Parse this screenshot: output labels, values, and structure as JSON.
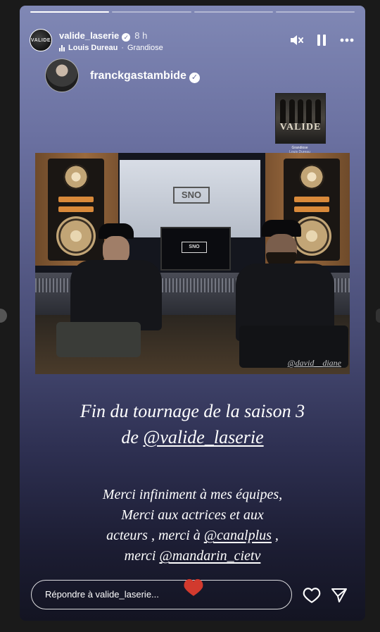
{
  "story": {
    "progress": [
      1,
      0,
      0,
      0
    ],
    "account": {
      "username": "valide_laserie",
      "time": "8 h",
      "avatar_text": "VALIDE"
    },
    "music": {
      "artist": "Louis Dureau",
      "separator": "·",
      "track": "Grandiose"
    },
    "icons": {
      "verified": "verified-badge-icon",
      "music": "music-bars-icon",
      "mute": "speaker-muted-icon",
      "pause": "pause-icon",
      "more": "more-horizontal-icon"
    }
  },
  "tagged": {
    "username": "franckgastambide"
  },
  "album": {
    "title": "VALIDE",
    "caption_line1": "Grandiose",
    "caption_line2": "Louis Dureau"
  },
  "photo": {
    "screen_logo": "SNO",
    "monitor_logo": "SNO",
    "credit": "@david__diane"
  },
  "caption1": {
    "line1": "Fin du tournage de la saison 3",
    "line2_prefix": "de ",
    "mention": "@valide_laserie"
  },
  "caption2": {
    "line1": "Merci infiniment à mes équipes,",
    "line2": "Merci aux actrices et aux",
    "line3_prefix": "acteurs , merci à ",
    "line3_mention": "@canalplus",
    "line3_suffix": " ,",
    "line4_prefix": "merci ",
    "line4_mention": "@mandarin_cietv"
  },
  "footer": {
    "reply_placeholder": "Répondre à valide_laserie...",
    "icons": {
      "like": "heart-outline-icon",
      "share": "send-icon",
      "reaction": "red-heart-icon"
    }
  }
}
